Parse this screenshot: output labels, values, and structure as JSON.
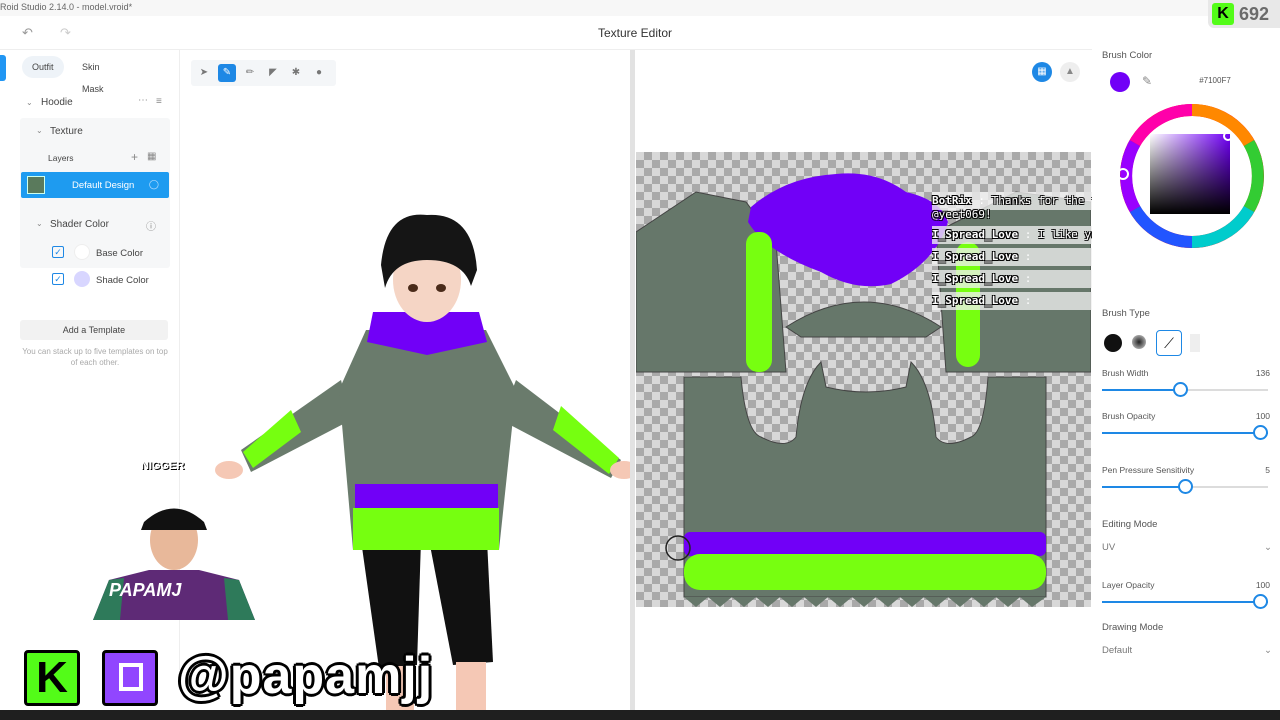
{
  "window": {
    "title": "Roid Studio 2.14.0 - model.vroid*",
    "editor_title": "Texture Editor"
  },
  "left_panel": {
    "tabs": [
      {
        "label": "Outfit"
      },
      {
        "label": "Skin Mask"
      }
    ],
    "hoodie_label": "Hoodie",
    "texture_label": "Texture",
    "layers_label": "Layers",
    "layer_name": "Default Design",
    "shader_color_label": "Shader Color",
    "base_color_label": "Base Color",
    "shade_color_label": "Shade Color",
    "add_template_label": "Add a Template",
    "template_note": "You can stack up to five templates on top of each other."
  },
  "right_panel": {
    "brush_color_label": "Brush Color",
    "brush_color_hex": "#7100F7",
    "brush_type_label": "Brush Type",
    "brush_width_label": "Brush Width",
    "brush_width_value": "136",
    "brush_width_fraction": 0.47,
    "brush_opacity_label": "Brush Opacity",
    "brush_opacity_value": "100",
    "brush_opacity_fraction": 1.0,
    "pen_pressure_label": "Pen Pressure Sensitivity",
    "pen_pressure_value": "5",
    "pen_pressure_fraction": 0.5,
    "editing_mode_label": "Editing Mode",
    "editing_mode_value": "UV",
    "layer_opacity_label": "Layer Opacity",
    "layer_opacity_value": "100",
    "layer_opacity_fraction": 1.0,
    "drawing_mode_label": "Drawing Mode",
    "drawing_mode_value": "Default"
  },
  "chat": [
    {
      "user": "BotRix",
      "message": "Thanks for the follow",
      "message2": "@yeet069!"
    },
    {
      "user": "I_Spread_Love",
      "message": "I like your hat"
    },
    {
      "user": "I_Spread_Love",
      "message": ""
    },
    {
      "user": "I_Spread_Love",
      "message": ""
    },
    {
      "user": "I_Spread_Love",
      "message": ""
    }
  ],
  "overlay": {
    "viewer_count": "692",
    "handle": "@papamjj",
    "cap_text": "NIGGER",
    "shirt_text": "PAPAMJ"
  },
  "colors": {
    "accent": "#1e88e5",
    "brush": "#7100F7",
    "hoodie": "#66776a",
    "lime": "#77ff10",
    "kick": "#53fc18",
    "twitch": "#9146ff"
  }
}
